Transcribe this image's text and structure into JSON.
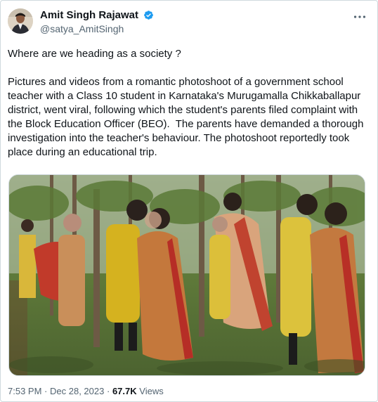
{
  "tweet": {
    "author_name": "Amit Singh Rajawat",
    "author_handle": "@satya_AmitSingh",
    "text": "Where are we heading as a society ?\n\nPictures and videos from a romantic photoshoot of a government school teacher with a Class 10 student in Karnataka's Murugamalla Chikkaballapur district, went viral, following which the student's parents filed complaint with the Block Education Officer (BEO).  The parents have demanded a thorough investigation into the teacher's behaviour. The photoshoot reportedly took place during an educational trip.",
    "time": "7:53 PM",
    "separator": "·",
    "date": "Dec 28, 2023",
    "views_count": "67.7K",
    "views_label": "Views"
  },
  "icons": {
    "verified": "verified-badge-icon",
    "more": "more-options-icon"
  },
  "colors": {
    "verified_blue": "#1d9bf0",
    "secondary_text": "#536471",
    "border": "#cfd9de"
  }
}
